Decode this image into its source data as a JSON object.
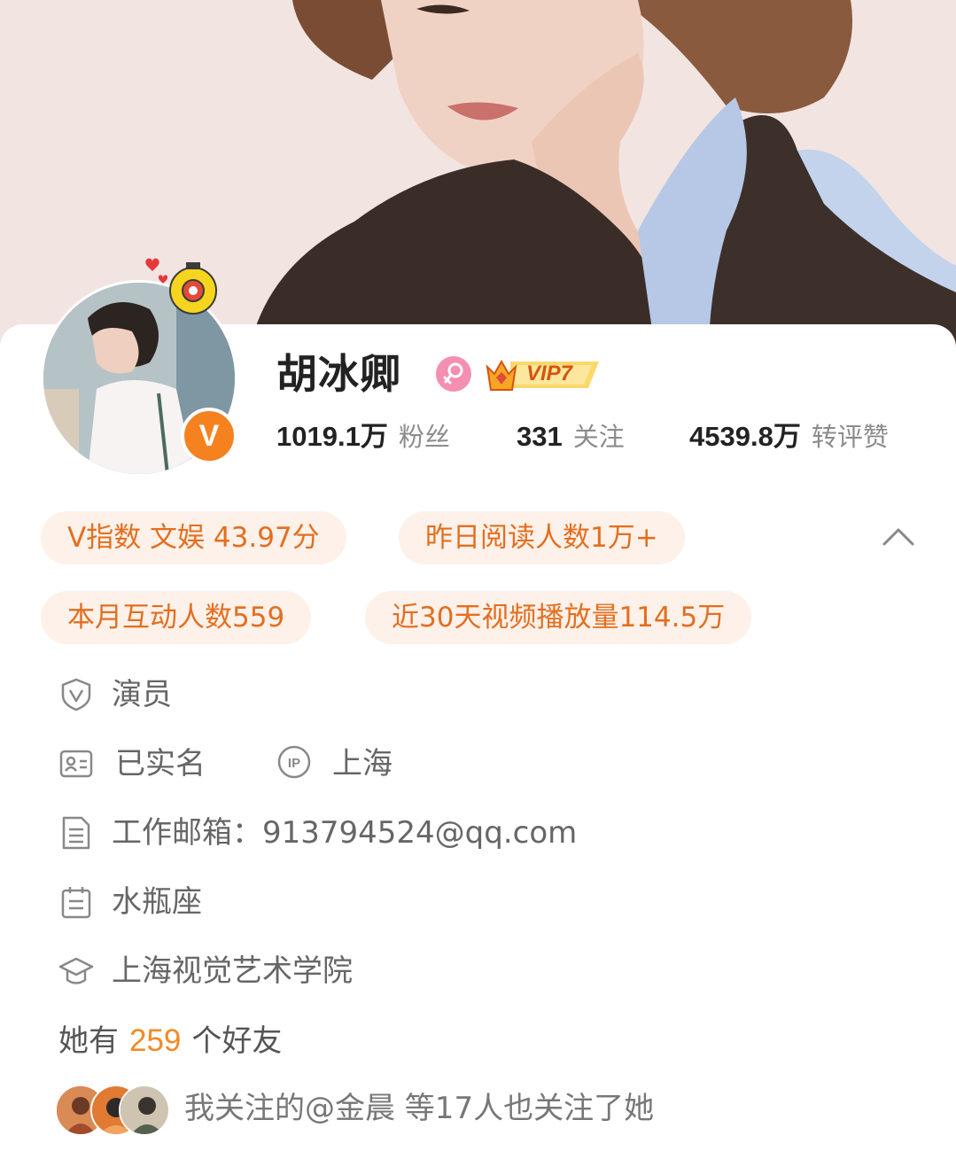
{
  "profile": {
    "name": "胡冰卿",
    "verified_mark": "V",
    "vip_label": "VIP7",
    "gender_icon": "female-icon"
  },
  "stats": [
    {
      "value": "1019.1万",
      "label": "粉丝"
    },
    {
      "value": "331",
      "label": "关注"
    },
    {
      "value": "4539.8万",
      "label": "转评赞"
    }
  ],
  "chips": {
    "v_index": "V指数 文娱 43.97分",
    "yesterday_reads": "昨日阅读人数1万+",
    "monthly_interactions": "本月互动人数559",
    "video_plays": "近30天视频播放量114.5万"
  },
  "info": {
    "occupation": "演员",
    "real_name": "已实名",
    "ip_location": "上海",
    "work_email": "工作邮箱：913794524@qq.com",
    "zodiac": "水瓶座",
    "school": "上海视觉艺术学院"
  },
  "friends": {
    "prefix": "她有",
    "count": "259",
    "suffix": "个好友"
  },
  "mutual": {
    "text": "我关注的@金晨 等17人也关注了她"
  },
  "colors": {
    "accent": "#e36f1f",
    "chip_bg": "#fdf1ea",
    "verified": "#f5821f",
    "gender": "#f48fb1"
  }
}
